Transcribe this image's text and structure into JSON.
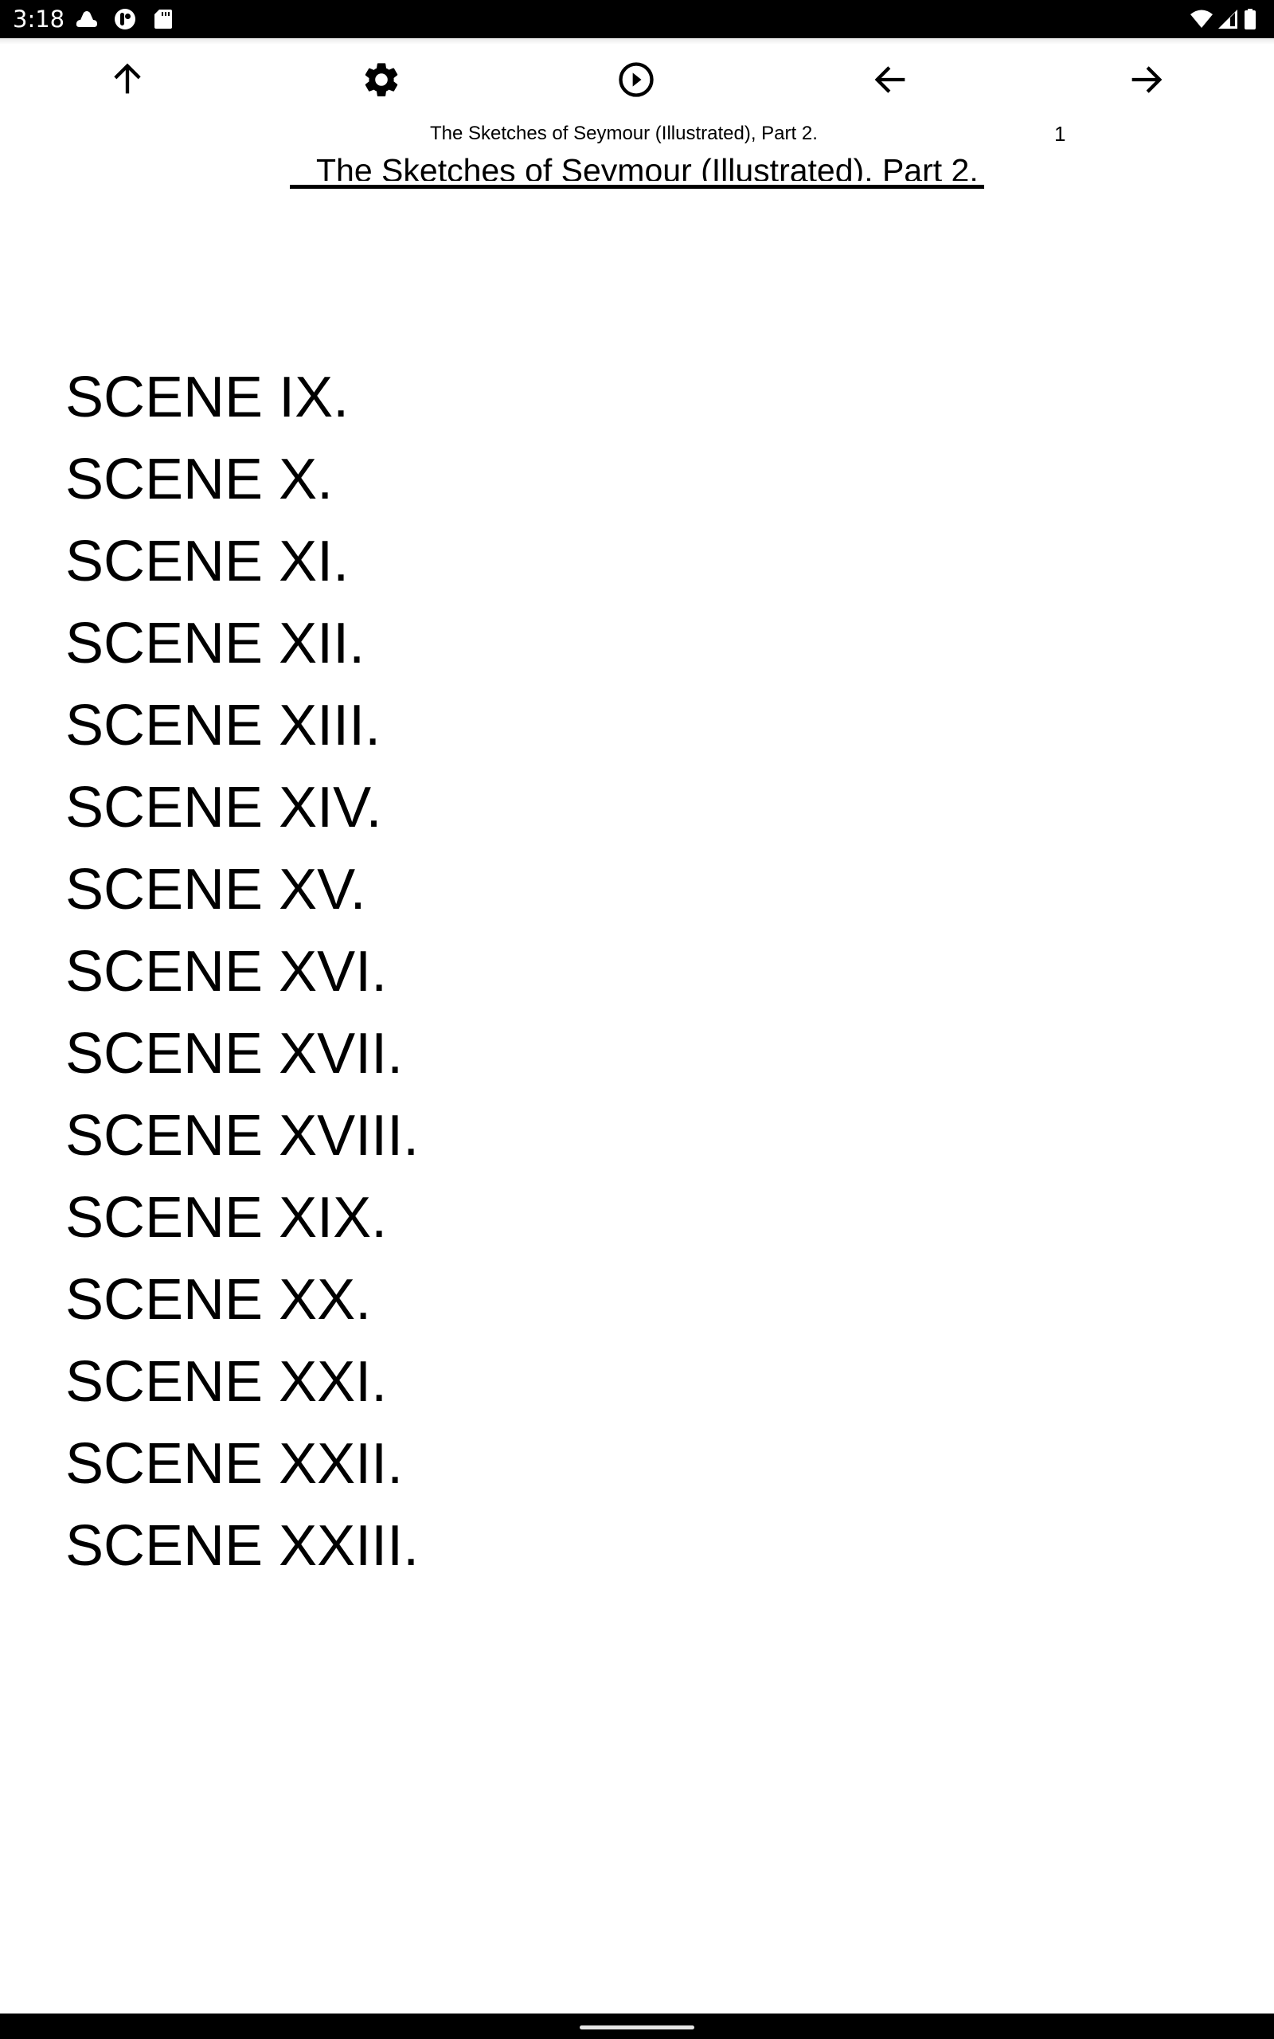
{
  "status_bar": {
    "time": "3:18",
    "left_icons": [
      "cloud-icon",
      "app-notification-icon",
      "sd-card-icon"
    ],
    "right_icons": [
      "wifi-icon",
      "cell-signal-icon",
      "battery-icon"
    ]
  },
  "toolbar": {
    "buttons": [
      {
        "name": "up",
        "icon": "arrow-up-icon"
      },
      {
        "name": "settings",
        "icon": "gear-icon"
      },
      {
        "name": "play",
        "icon": "play-circle-icon"
      },
      {
        "name": "previous",
        "icon": "arrow-left-icon"
      },
      {
        "name": "next",
        "icon": "arrow-right-icon"
      }
    ]
  },
  "reader": {
    "book_title": "The Sketches of Seymour (Illustrated), Part 2.",
    "page_number": "1",
    "chapter_heading": "The Sketches of Seymour (Illustrated), Part 2.",
    "scenes": [
      "SCENE IX.",
      "SCENE X.",
      "SCENE XI.",
      "SCENE XII.",
      "SCENE XIII.",
      "SCENE XIV.",
      "SCENE XV.",
      "SCENE XVI.",
      "SCENE XVII.",
      "SCENE XVIII.",
      "SCENE XIX.",
      "SCENE XX.",
      "SCENE XXI.",
      "SCENE XXII.",
      "SCENE XXIII."
    ]
  },
  "colors": {
    "background": "#ffffff",
    "text": "#000000",
    "system_bars": "#000000"
  }
}
